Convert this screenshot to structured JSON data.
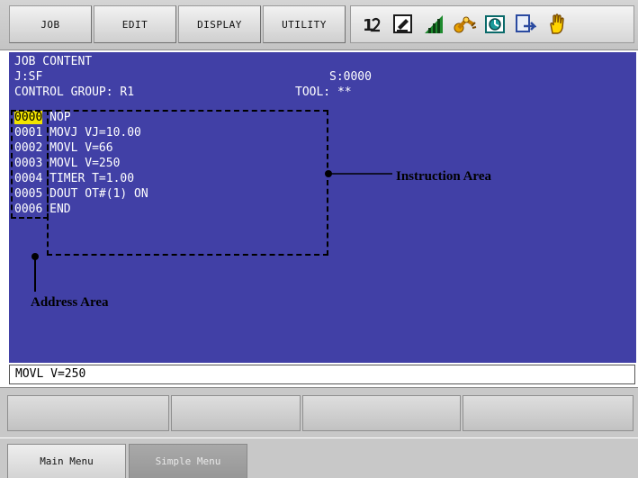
{
  "menubar": {
    "job": "JOB",
    "edit": "EDIT",
    "display": "DISPLAY",
    "utility": "UTILITY",
    "status_icons": [
      "axis-select-icon",
      "edit-mode-icon",
      "speed-meter-icon",
      "robot-arm-icon",
      "teach-mode-icon",
      "step-icon",
      "hand-safety-icon"
    ]
  },
  "job_content": {
    "title": "JOB CONTENT",
    "job_name": "J:SF",
    "step": "S:0000",
    "control_group": "CONTROL GROUP: R1",
    "tool": "TOOL: **",
    "lines": [
      {
        "addr": "0000",
        "instr": "NOP"
      },
      {
        "addr": "0001",
        "instr": "MOVJ VJ=10.00"
      },
      {
        "addr": "0002",
        "instr": "MOVL V=66"
      },
      {
        "addr": "0003",
        "instr": "MOVL V=250"
      },
      {
        "addr": "0004",
        "instr": "TIMER T=1.00"
      },
      {
        "addr": "0005",
        "instr": "DOUT OT#(1) ON"
      },
      {
        "addr": "0006",
        "instr": "END"
      }
    ],
    "annotations": {
      "instruction_area": "Instruction Area",
      "address_area": "Address Area"
    }
  },
  "input_line": "MOVL V=250",
  "bottom_tabs": {
    "main_menu": "Main Menu",
    "simple_menu": "Simple Menu"
  },
  "colors": {
    "content_bg": "#4140a6",
    "address_highlight": "#f2e400"
  }
}
